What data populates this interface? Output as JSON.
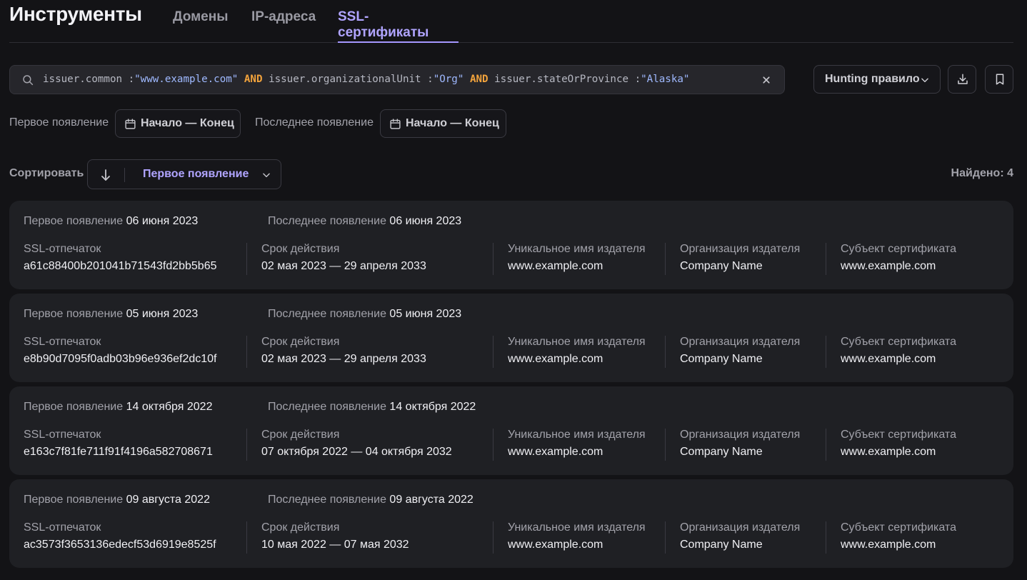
{
  "header": {
    "title": "Инструменты",
    "tabs": [
      "Домены",
      "IP-адреса",
      "SSL-сертификаты"
    ]
  },
  "search": {
    "query": [
      {
        "t": "issuer.common :",
        "c": "key"
      },
      {
        "t": "\"www.example.com\"",
        "c": "str"
      },
      {
        "t": " AND ",
        "c": "op"
      },
      {
        "t": "issuer.organizationalUnit :",
        "c": "key"
      },
      {
        "t": "\"Org\"",
        "c": "str"
      },
      {
        "t": " AND ",
        "c": "op"
      },
      {
        "t": "issuer.stateOrProvince :",
        "c": "key"
      },
      {
        "t": "\"Alaska\"",
        "c": "str"
      }
    ]
  },
  "toolbar": {
    "hunting_label": "Hunting правило"
  },
  "filters": {
    "first_label": "Первое появление",
    "first_value": "Начало — Конец",
    "last_label": "Последнее появление",
    "last_value": "Начало — Конец"
  },
  "sort": {
    "label": "Сортировать",
    "value": "Первое появление",
    "found": "Найдено: 4"
  },
  "labels": {
    "first_seen": "Первое появление",
    "last_seen": "Последнее появление",
    "fingerprint": "SSL-отпечаток",
    "validity": "Срок действия",
    "issuer_cn": "Уникальное имя издателя",
    "issuer_org": "Организация издателя",
    "subject": "Субъект сертификата"
  },
  "results": [
    {
      "first_seen": "06 июня 2023",
      "last_seen": "06 июня 2023",
      "fingerprint": "a61c88400b201041b71543fd2bb5b65",
      "validity": "02 мая 2023 — 29 апреля 2033",
      "issuer_cn": "www.example.com",
      "issuer_org": "Company Name",
      "subject": "www.example.com"
    },
    {
      "first_seen": "05 июня 2023",
      "last_seen": "05 июня 2023",
      "fingerprint": "e8b90d7095f0adb03b96e936ef2dc10f",
      "validity": "02 мая 2023 — 29 апреля 2033",
      "issuer_cn": "www.example.com",
      "issuer_org": "Company Name",
      "subject": "www.example.com"
    },
    {
      "first_seen": "14 октября 2022",
      "last_seen": "14 октября 2022",
      "fingerprint": "e163c7f81fe711f91f4196a582708671",
      "validity": "07 октября 2022 — 04 октября 2032",
      "issuer_cn": "www.example.com",
      "issuer_org": "Company Name",
      "subject": "www.example.com"
    },
    {
      "first_seen": "09 августа 2022",
      "last_seen": "09 августа 2022",
      "fingerprint": "ac3573f3653136edecf53d6919e8525f",
      "validity": "10 мая 2022 — 07 мая 2032",
      "issuer_cn": "www.example.com",
      "issuer_org": "Company Name",
      "subject": "www.example.com"
    }
  ]
}
